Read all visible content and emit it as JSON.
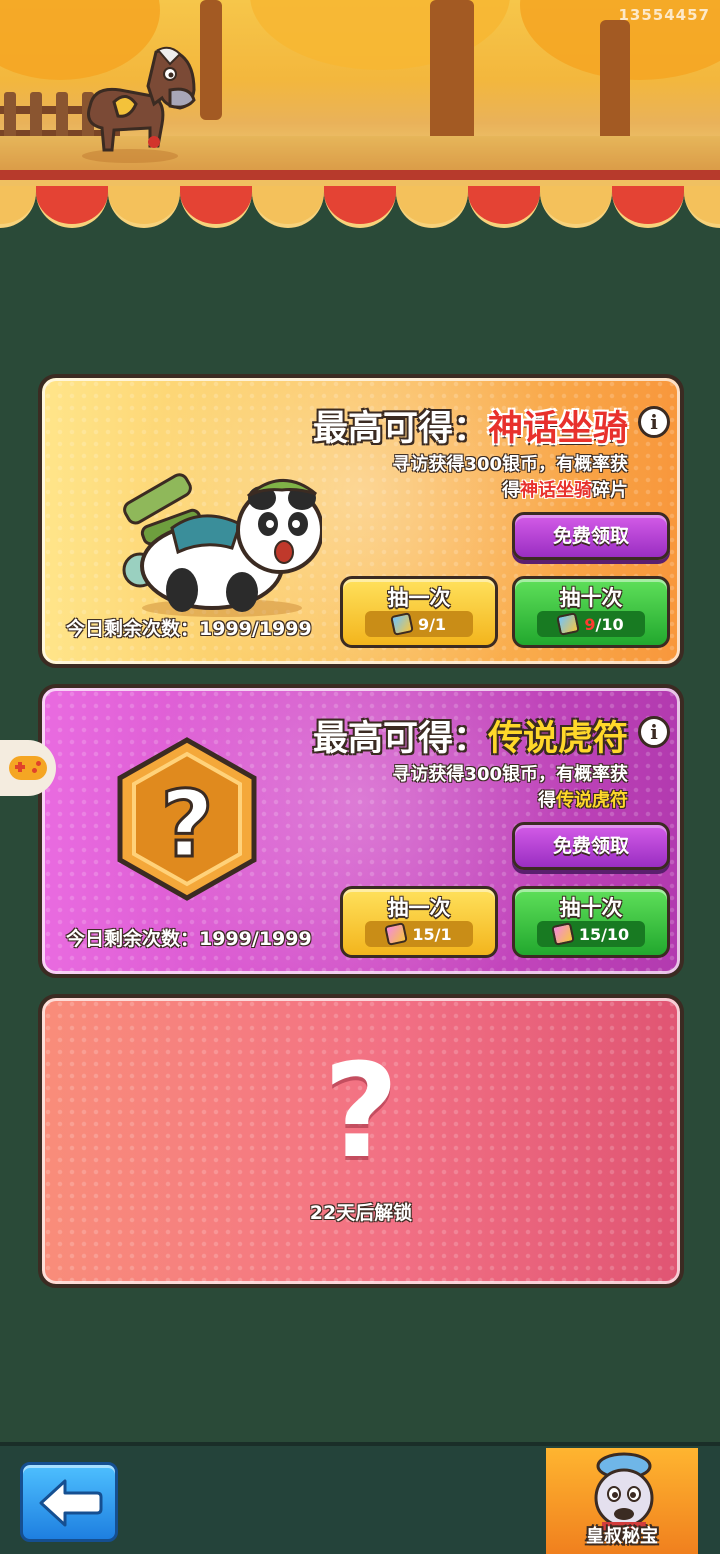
{
  "header": {
    "user_id": "13554457"
  },
  "cards": [
    {
      "headline_prefix": "最高可得：",
      "headline_reward": "神话坐骑",
      "desc_line1": "寻访获得300银币，有概率获",
      "desc_line2_pre": "得",
      "desc_line2_em": "神话坐骑",
      "desc_line2_post": "碎片",
      "free_label": "免费领取",
      "draw_one_label": "抽一次",
      "draw_one_cost": "9/1",
      "draw_ten_label": "抽十次",
      "draw_ten_cost_have": "9",
      "draw_ten_cost_need": "/10",
      "remaining": "今日剩余次数：1999/1999",
      "token_icon": "mount-token-icon"
    },
    {
      "headline_prefix": "最高可得：",
      "headline_reward": "传说虎符",
      "desc_line1": "寻访获得300银币，有概率获",
      "desc_line2_pre": "得",
      "desc_line2_em": "传说虎符",
      "desc_line2_post": "",
      "free_label": "免费领取",
      "draw_one_label": "抽一次",
      "draw_one_cost": "15/1",
      "draw_ten_label": "抽十次",
      "draw_ten_cost": "15/10",
      "remaining": "今日剩余次数：1999/1999",
      "token_icon": "tiger-token-icon"
    },
    {
      "lock_text": "22天后解锁"
    }
  ],
  "bottom": {
    "back_icon": "back-arrow-icon",
    "uncle_label": "皇叔秘宝"
  },
  "colors": {
    "background": "#2a4a38",
    "mount_accent": "#e8312c",
    "tiger_accent": "#ffd82a",
    "free_button": "#9a2ec2",
    "draw_one_button": "#f3b51d",
    "draw_ten_button": "#22a82e"
  }
}
